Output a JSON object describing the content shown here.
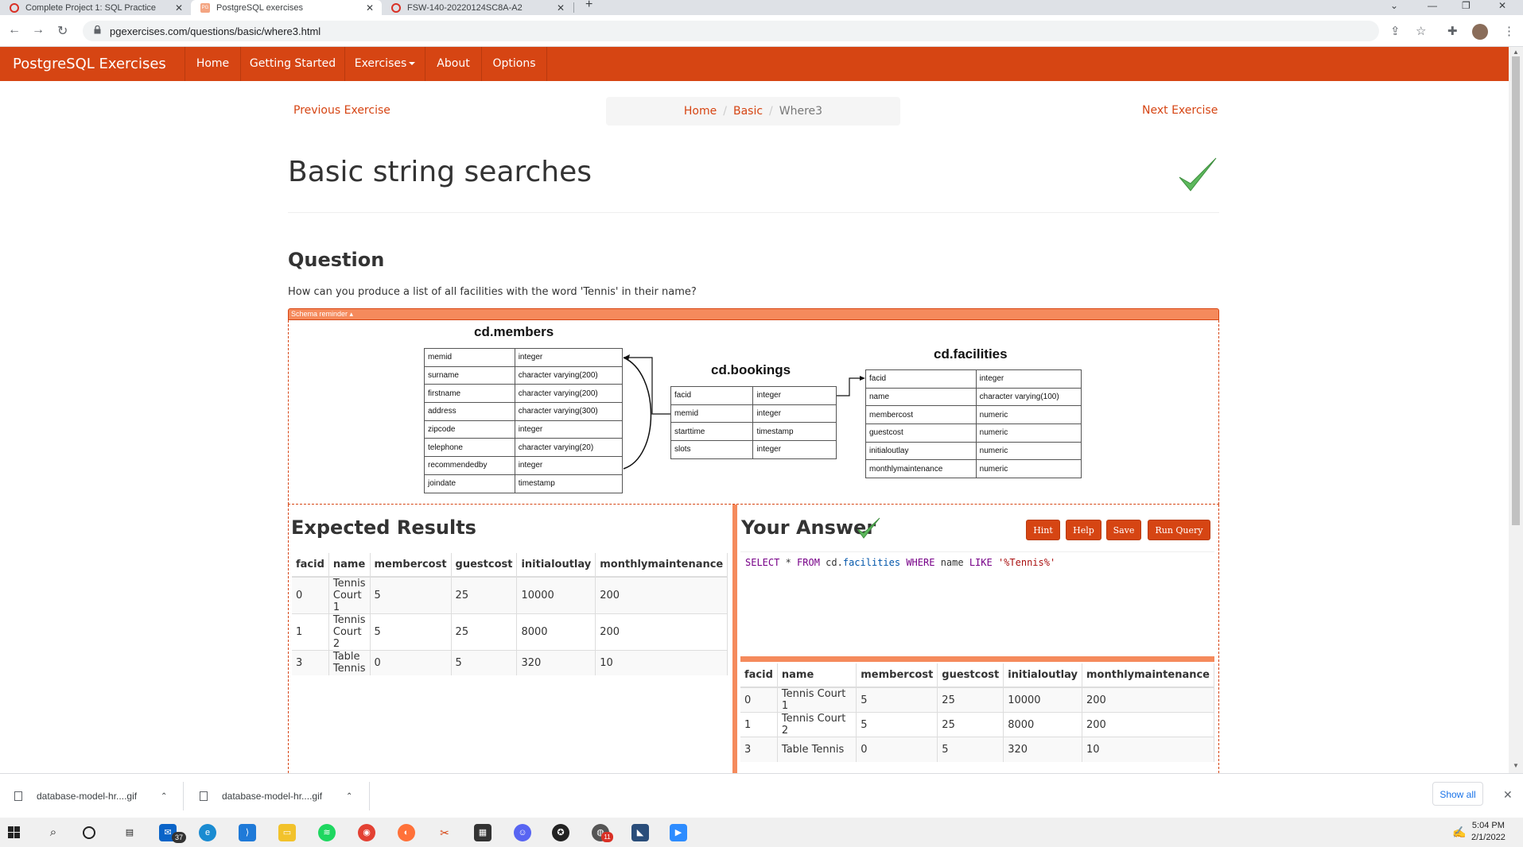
{
  "browser": {
    "tabs": [
      {
        "title": "Complete Project 1: SQL Practice"
      },
      {
        "title": "PostgreSQL exercises"
      },
      {
        "title": "FSW-140-20220124SC8A-A2"
      }
    ],
    "url": "pgexercises.com/questions/basic/where3.html"
  },
  "navbar": {
    "brand": "PostgreSQL Exercises",
    "items": [
      "Home",
      "Getting Started",
      "Exercises",
      "About",
      "Options"
    ]
  },
  "pager": {
    "previous": "Previous Exercise",
    "next": "Next Exercise",
    "breadcrumb": [
      "Home",
      "Basic",
      "Where3"
    ]
  },
  "title": "Basic string searches",
  "question": {
    "heading": "Question",
    "text": "How can you produce a list of all facilities with the word 'Tennis' in their name?"
  },
  "schema": {
    "toggle_label": "Schema reminder ▴",
    "members": {
      "name": "cd.members",
      "rows": [
        [
          "memid",
          "integer"
        ],
        [
          "surname",
          "character varying(200)"
        ],
        [
          "firstname",
          "character varying(200)"
        ],
        [
          "address",
          "character varying(300)"
        ],
        [
          "zipcode",
          "integer"
        ],
        [
          "telephone",
          "character varying(20)"
        ],
        [
          "recommendedby",
          "integer"
        ],
        [
          "joindate",
          "timestamp"
        ]
      ]
    },
    "bookings": {
      "name": "cd.bookings",
      "rows": [
        [
          "facid",
          "integer"
        ],
        [
          "memid",
          "integer"
        ],
        [
          "starttime",
          "timestamp"
        ],
        [
          "slots",
          "integer"
        ]
      ]
    },
    "facilities": {
      "name": "cd.facilities",
      "rows": [
        [
          "facid",
          "integer"
        ],
        [
          "name",
          "character varying(100)"
        ],
        [
          "membercost",
          "numeric"
        ],
        [
          "guestcost",
          "numeric"
        ],
        [
          "initialoutlay",
          "numeric"
        ],
        [
          "monthlymaintenance",
          "numeric"
        ]
      ]
    }
  },
  "expected": {
    "heading": "Expected Results",
    "columns": [
      "facid",
      "name",
      "membercost",
      "guestcost",
      "initialoutlay",
      "monthlymaintenance"
    ],
    "rows": [
      [
        "0",
        "Tennis Court 1",
        "5",
        "25",
        "10000",
        "200"
      ],
      [
        "1",
        "Tennis Court 2",
        "5",
        "25",
        "8000",
        "200"
      ],
      [
        "3",
        "Table Tennis",
        "0",
        "5",
        "320",
        "10"
      ]
    ]
  },
  "answer": {
    "heading": "Your Answer",
    "buttons": [
      "Hint",
      "Help",
      "Save",
      "Run Query"
    ],
    "sql": {
      "kw1": "SELECT",
      "star": " * ",
      "kw2": "FROM",
      "schema": " cd.",
      "table": "facilities",
      "kw3": " WHERE ",
      "col": "name ",
      "kw4": "LIKE",
      "str": " '%Tennis%'"
    },
    "columns": [
      "facid",
      "name",
      "membercost",
      "guestcost",
      "initialoutlay",
      "monthlymaintenance"
    ],
    "rows": [
      [
        "0",
        "Tennis Court 1",
        "5",
        "25",
        "10000",
        "200"
      ],
      [
        "1",
        "Tennis Court 2",
        "5",
        "25",
        "8000",
        "200"
      ],
      [
        "3",
        "Table Tennis",
        "0",
        "5",
        "320",
        "10"
      ]
    ]
  },
  "downloads": {
    "items": [
      "database-model-hr....gif",
      "database-model-hr....gif"
    ],
    "show_all": "Show all"
  },
  "taskbar": {
    "mail_badge": "37",
    "badge2": "11",
    "time": "5:04 PM",
    "date": "2/1/2022"
  },
  "colors": {
    "brand": "#d64513",
    "accent_light": "#f58a5c",
    "check": "#5cb85c"
  }
}
